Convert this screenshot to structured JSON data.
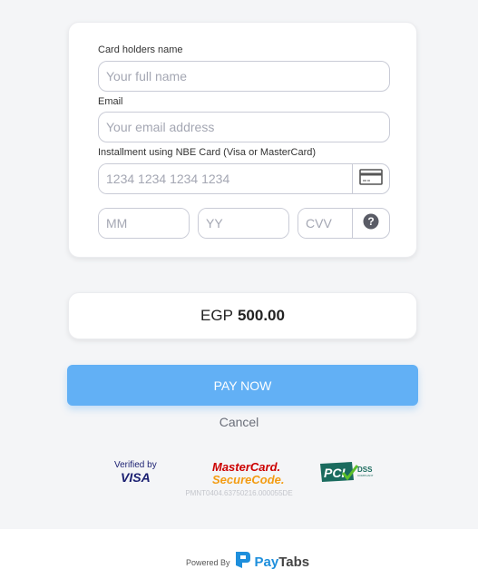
{
  "form": {
    "name_label": "Card holders name",
    "name_placeholder": "Your full name",
    "name_value": "",
    "email_label": "Email",
    "email_placeholder": "Your email address",
    "email_value": "",
    "card_label": "Installment using NBE Card (Visa or MasterCard)",
    "card_placeholder": "1234 1234 1234 1234",
    "card_value": "",
    "card_icon": "credit-card-icon",
    "month_placeholder": "MM",
    "year_placeholder": "YY",
    "cvv_placeholder": "CVV",
    "cvv_help_icon": "question-circle-icon"
  },
  "amount": {
    "currency": "EGP",
    "value": "500.00"
  },
  "actions": {
    "pay_label": "PAY NOW",
    "cancel_label": "Cancel"
  },
  "badges": {
    "visa_line1": "Verified by",
    "visa_line2": "VISA",
    "mastercard_line1": "MasterCard.",
    "mastercard_line2": "SecureCode.",
    "pci_text": "PCI",
    "pci_dss": "DSS",
    "pci_sub": "COMPLIANT"
  },
  "reference": "PMNT0404.63750216.000055DE",
  "footer": {
    "powered_by": "Powered By",
    "brand_pay": "Pay",
    "brand_tabs": "Tabs"
  },
  "colors": {
    "accent": "#62b0f5",
    "brand_blue": "#1e8fdc",
    "background": "#f4f5f7"
  }
}
